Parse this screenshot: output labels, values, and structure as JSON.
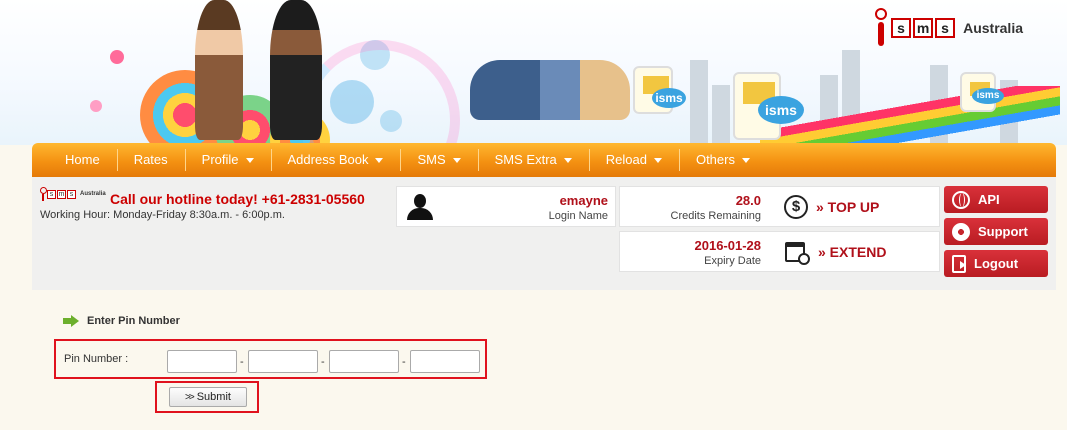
{
  "brand": {
    "logo_letters": [
      "s",
      "m",
      "s"
    ],
    "logo_word": "Australia",
    "bubble_text": "isms",
    "accent": "#f49112",
    "red": "#b0101a"
  },
  "nav": {
    "items": [
      {
        "label": "Home",
        "has_caret": false
      },
      {
        "label": "Rates",
        "has_caret": false
      },
      {
        "label": "Profile",
        "has_caret": true
      },
      {
        "label": "Address Book",
        "has_caret": true
      },
      {
        "label": "SMS",
        "has_caret": true
      },
      {
        "label": "SMS Extra",
        "has_caret": true
      },
      {
        "label": "Reload",
        "has_caret": true
      },
      {
        "label": "Others",
        "has_caret": true
      }
    ]
  },
  "contact": {
    "hotline": "Call our hotline today! +61-2831-05560",
    "hours": "Working Hour: Monday-Friday 8:30a.m. - 6:00p.m."
  },
  "user": {
    "name": "emayne",
    "name_label": "Login Name",
    "icon": "user-silhouette-icon"
  },
  "credits": {
    "value": "28.0",
    "label": "Credits Remaining",
    "action": "» TOP UP",
    "icon": "dollar-coin-icon"
  },
  "expiry": {
    "value": "2016-01-28",
    "label": "Expiry Date",
    "action": "» EXTEND",
    "icon": "calendar-clock-icon"
  },
  "side_buttons": [
    {
      "label": "API",
      "icon": "globe-icon"
    },
    {
      "label": "Support",
      "icon": "lifebuoy-icon"
    },
    {
      "label": "Logout",
      "icon": "logout-icon"
    }
  ],
  "pin_form": {
    "title": "Enter Pin Number",
    "label": "Pin Number :",
    "separator": "-",
    "fields": [
      "",
      "",
      "",
      ""
    ],
    "submit_label": "Submit"
  }
}
